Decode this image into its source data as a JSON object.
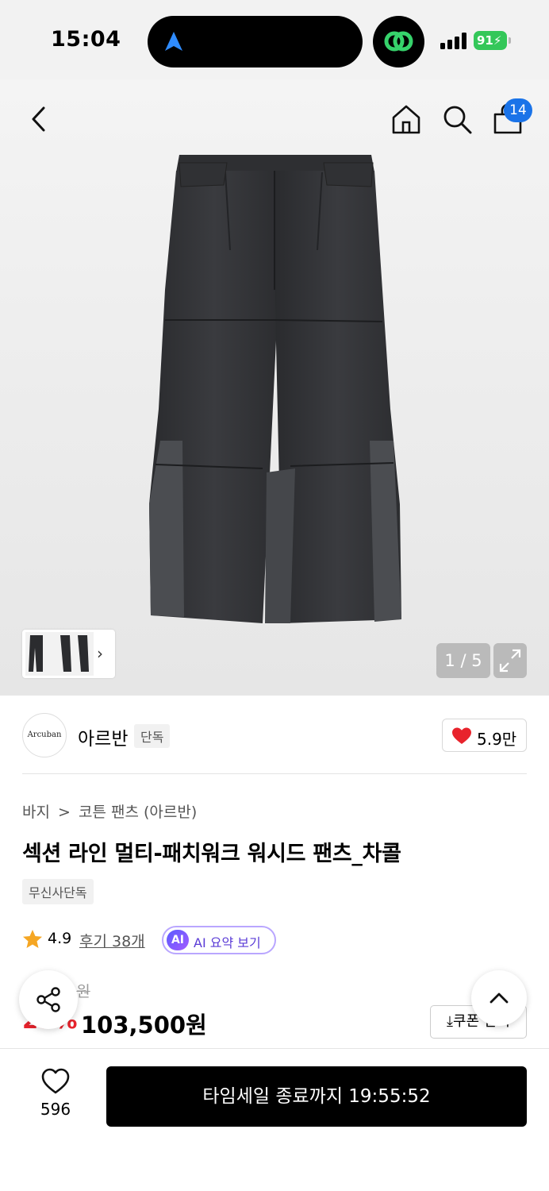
{
  "status_bar": {
    "time": "15:04",
    "battery": "91"
  },
  "header": {
    "icons": [
      "back-icon",
      "home-icon",
      "search-icon",
      "shopping-bag-icon"
    ],
    "cart_badge": "14"
  },
  "gallery": {
    "pager": "1 / 5",
    "thumbnail_next": "›"
  },
  "brand": {
    "logo_text": "Arcuban",
    "name": "아르반",
    "tag": "단독",
    "likes": "5.9만"
  },
  "product": {
    "breadcrumb": [
      "바지",
      ">",
      "코튼 팬츠 (아르반)"
    ],
    "title": "섹션 라인 멀티-패치워크 워시드 팬츠_차콜",
    "exclusive_tag": "무신사단독",
    "rating": "4.9",
    "reviews": "후기 38개",
    "ai_badge": "AI",
    "ai_summary": "AI 요약 보기",
    "original_price": "1__,__0원",
    "discount": "25%",
    "sale_price": "103,500원",
    "coupon_button": "⤓쿠폰 받기"
  },
  "bottom_bar": {
    "wishlist_count": "596",
    "buy_button": "타임세일 종료까지 19:55:52"
  },
  "colors": {
    "accent_blue": "#1a73e8",
    "discount_red": "#e8232c",
    "battery_green": "#34c759",
    "ai_purple": "#5a3bd6"
  }
}
